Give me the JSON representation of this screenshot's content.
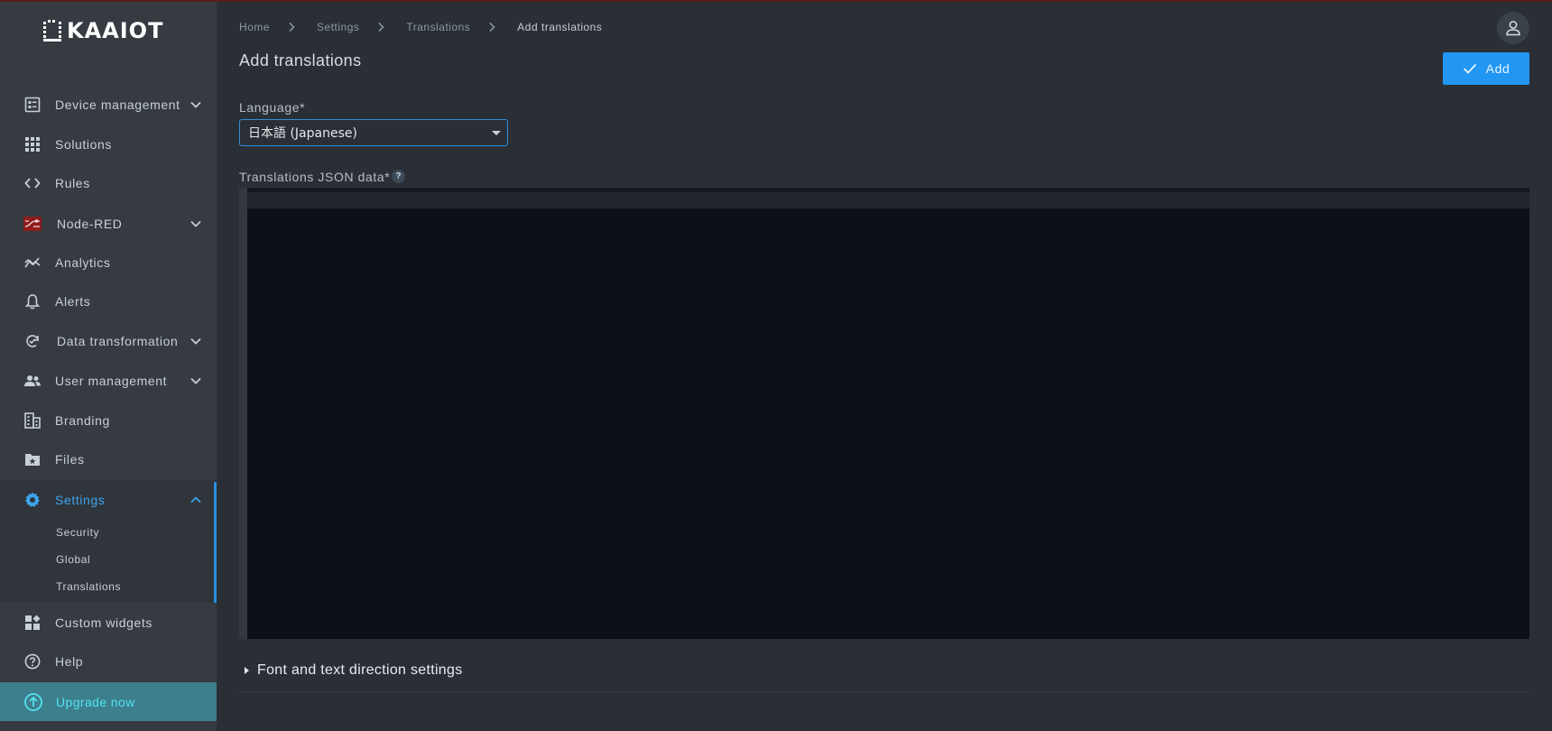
{
  "brand": {
    "logo_text": "KAAIOT"
  },
  "sidebar": {
    "items": [
      {
        "label": "Device management"
      },
      {
        "label": "Solutions"
      },
      {
        "label": "Rules"
      },
      {
        "label": "Node-RED"
      },
      {
        "label": "Analytics"
      },
      {
        "label": "Alerts"
      },
      {
        "label": "Data transformation"
      },
      {
        "label": "User management"
      },
      {
        "label": "Branding"
      },
      {
        "label": "Files"
      },
      {
        "label": "Settings"
      },
      {
        "label": "Custom widgets"
      },
      {
        "label": "Help"
      }
    ],
    "settings_subitems": [
      {
        "label": "Security"
      },
      {
        "label": "Global"
      },
      {
        "label": "Translations"
      }
    ],
    "upgrade_label": "Upgrade now",
    "active_color": "#3fa4ee",
    "upgrade_color": "#52e3ee"
  },
  "breadcrumb": [
    "Home",
    "Settings",
    "Translations",
    "Add translations"
  ],
  "page": {
    "title": "Add translations",
    "add_button_label": "Add",
    "language_label": "Language*",
    "language_value": "日本語 (Japanese)",
    "json_label": "Translations JSON data*",
    "help_glyph": "?",
    "editor_content": "",
    "font_settings_label": "Font and text direction settings"
  },
  "colors": {
    "accent": "#2196f3",
    "sidebar_bg": "#353b41",
    "main_bg": "#2a2f35",
    "editor_bg": "#0d1117"
  }
}
